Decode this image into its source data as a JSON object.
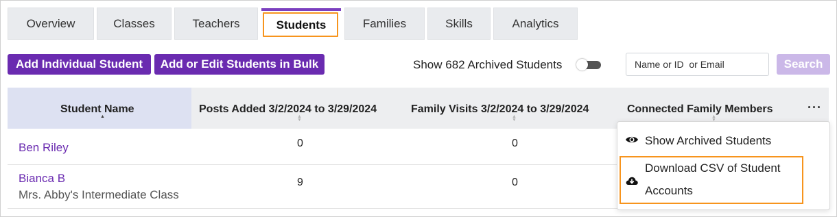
{
  "tabs": [
    "Overview",
    "Classes",
    "Teachers",
    "Students",
    "Families",
    "Skills",
    "Analytics"
  ],
  "toolbar": {
    "add_individual_label": "Add Individual Student",
    "add_bulk_label": "Add or Edit Students in Bulk",
    "archived_toggle_label": "Show 682 Archived Students",
    "archived_toggle_on": false,
    "search_placeholder": "Name or ID  or Email",
    "search_button_label": "Search"
  },
  "table": {
    "columns": [
      "Student Name",
      "Posts Added 3/2/2024 to 3/29/2024",
      "Family Visits 3/2/2024 to 3/29/2024",
      "Connected Family Members"
    ],
    "rows": [
      {
        "name": "Ben Riley",
        "class": "",
        "posts": "0",
        "visits": "0"
      },
      {
        "name": "Bianca B",
        "class": "Mrs. Abby's Intermediate Class",
        "posts": "9",
        "visits": "0"
      }
    ]
  },
  "menu": {
    "items": [
      {
        "label": "Show Archived Students",
        "icon": "eye-icon"
      },
      {
        "label_line1": "Download CSV of Student",
        "label_line2": "Accounts",
        "icon": "cloud-download-icon"
      }
    ]
  },
  "colors": {
    "accent": "#6a2bb0",
    "highlight": "#f7941d"
  }
}
